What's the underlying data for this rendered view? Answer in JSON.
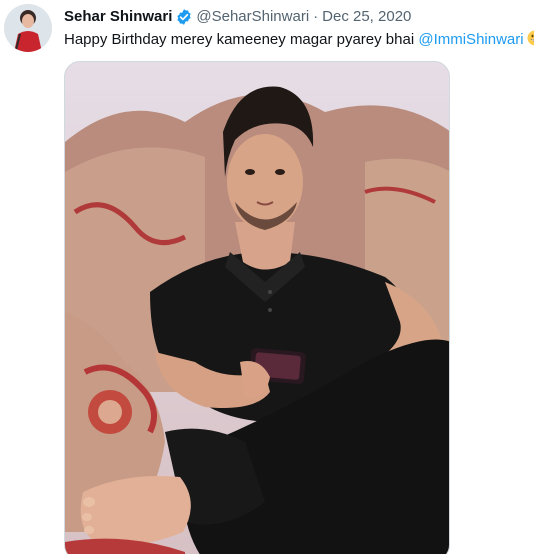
{
  "tweet": {
    "author_name": "Sehar Shinwari",
    "handle": "@SeharShinwari",
    "separator": "·",
    "date": "Dec 25, 2020",
    "text": "Happy Birthday merey kameeney magar pyarey bhai ",
    "mention": "@ImmiShinwari",
    "emoji_icon": "grinning-face-icon",
    "verified_icon": "verified-badge-icon"
  },
  "colors": {
    "text": "#0f1419",
    "secondary": "#536471",
    "link": "#1d9bf0",
    "verified": "#1d9bf0",
    "media_border": "#cfd9de"
  }
}
